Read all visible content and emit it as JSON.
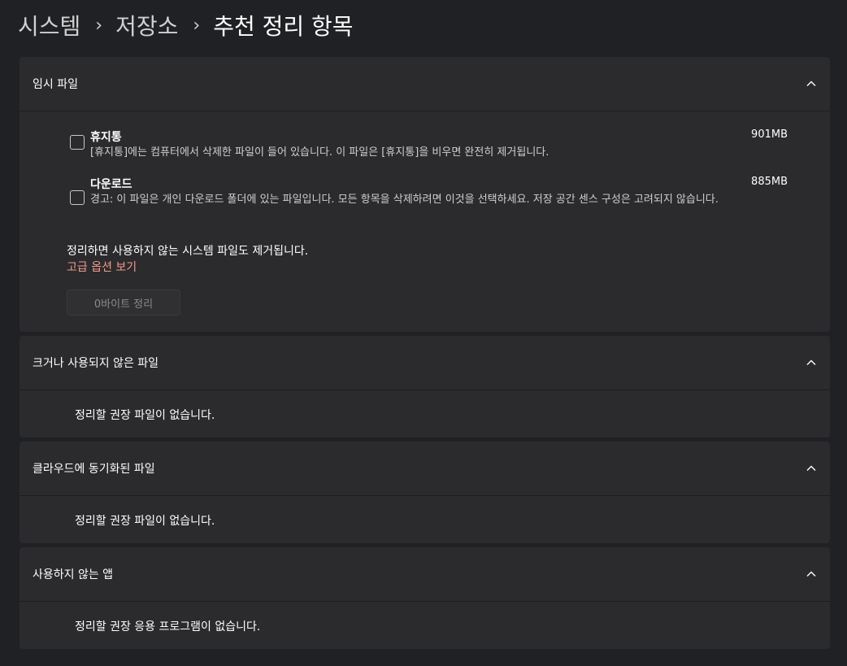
{
  "breadcrumb": {
    "items": [
      "시스템",
      "저장소",
      "추천 정리 항목"
    ],
    "separator": "›"
  },
  "sections": [
    {
      "title": "임시 파일",
      "items": [
        {
          "name": "휴지통",
          "size": "901MB",
          "description": "[휴지통]에는 컴퓨터에서 삭제한 파일이 들어 있습니다. 이 파일은 [휴지통]을 비우면 완전히 제거됩니다.",
          "checked": false
        },
        {
          "name": "다운로드",
          "size": "885MB",
          "description": "경고: 이 파일은 개인 다운로드 폴더에 있는 파일입니다. 모든 항목을 삭제하려면 이것을 선택하세요. 저장 공간 센스 구성은 고려되지 않습니다.",
          "checked": false
        }
      ],
      "note": "정리하면 사용하지 않는 시스템 파일도 제거됩니다.",
      "advanced_link": "고급 옵션 보기",
      "clean_button": "0바이트 정리"
    },
    {
      "title": "크거나 사용되지 않은 파일",
      "empty_message": "정리할 권장 파일이 없습니다."
    },
    {
      "title": "클라우드에 동기화된 파일",
      "empty_message": "정리할 권장 파일이 없습니다."
    },
    {
      "title": "사용하지 않는 앱",
      "empty_message": "정리할 권장 응용 프로그램이 없습니다."
    }
  ],
  "icons": {
    "chevron": "chevron-up-icon"
  },
  "colors": {
    "background": "#202124",
    "card": "#2b2b2e",
    "accent_link": "#f29a8a"
  }
}
